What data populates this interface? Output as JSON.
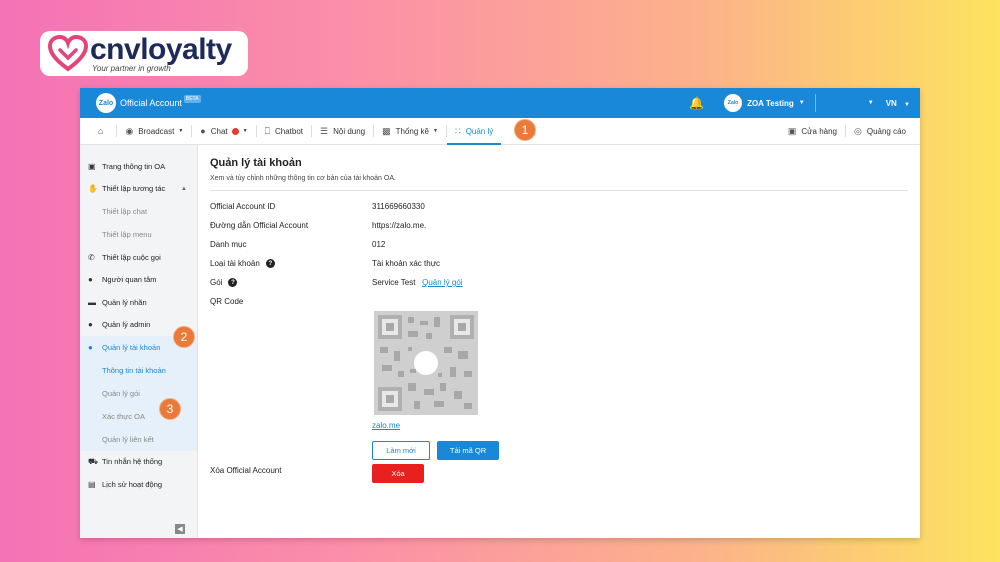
{
  "brand": {
    "name": "cnvloyalty",
    "tagline": "Your partner in growth"
  },
  "topbar": {
    "logo": "Zalo",
    "title": "Official Account",
    "beta": "BETA",
    "account_name": "ZOA Testing",
    "account_logo": "Zalo",
    "language": "VN"
  },
  "nav": {
    "home_icon": "home-icon",
    "items": [
      {
        "label": "Broadcast",
        "icon": "broadcast-icon"
      },
      {
        "label": "Chat",
        "icon": "chat-icon"
      },
      {
        "label": "Chatbot",
        "icon": "chatbot-icon"
      },
      {
        "label": "Nội dung",
        "icon": "list-icon"
      },
      {
        "label": "Thống kê",
        "icon": "bar-chart-icon"
      },
      {
        "label": "Quản lý",
        "icon": "grid-icon"
      }
    ],
    "right": [
      {
        "label": "Cửa hàng",
        "icon": "store-icon"
      },
      {
        "label": "Quảng cáo",
        "icon": "ads-icon"
      }
    ]
  },
  "steps": {
    "one": "1",
    "two": "2",
    "three": "3"
  },
  "sidebar": {
    "items": [
      {
        "label": "Trang thông tin OA"
      },
      {
        "label": "Thiết lập tương tác"
      },
      {
        "label": "Thiết lập chat"
      },
      {
        "label": "Thiết lập menu"
      },
      {
        "label": "Thiết lập cuộc gọi"
      },
      {
        "label": "Người quan tâm"
      },
      {
        "label": "Quản lý nhãn"
      },
      {
        "label": "Quản lý admin"
      },
      {
        "label": "Quản lý tài khoản"
      },
      {
        "label": "Thông tin tài khoản"
      },
      {
        "label": "Quản lý gói"
      },
      {
        "label": "Xác thực OA"
      },
      {
        "label": "Quản lý liên kết"
      },
      {
        "label": "Tin nhắn hệ thống"
      },
      {
        "label": "Lịch sử hoạt động"
      }
    ]
  },
  "page": {
    "title": "Quản lý tài khoản",
    "subtitle": "Xem và tùy chỉnh những thông tin cơ bản của tài khoản OA.",
    "fields": {
      "oa_id_label": "Official Account ID",
      "oa_id_value": "311669660330",
      "link_label": "Đường dẫn Official Account",
      "link_value": "https://zalo.me.",
      "category_label": "Danh mục",
      "category_value": "012",
      "type_label": "Loại tài khoản",
      "type_value": "Tài khoản xác thực",
      "package_label": "Gói",
      "package_value": "Service Test",
      "package_link": "Quản lý gói",
      "qr_label": "QR Code",
      "qr_link": "zalo.me",
      "delete_label": "Xóa Official Account"
    },
    "buttons": {
      "refresh": "Làm mới",
      "download": "Tải mã QR",
      "delete": "Xóa"
    }
  },
  "colors": {
    "primary": "#1a88d8",
    "danger": "#e8211f",
    "step": "#e97a3a"
  }
}
